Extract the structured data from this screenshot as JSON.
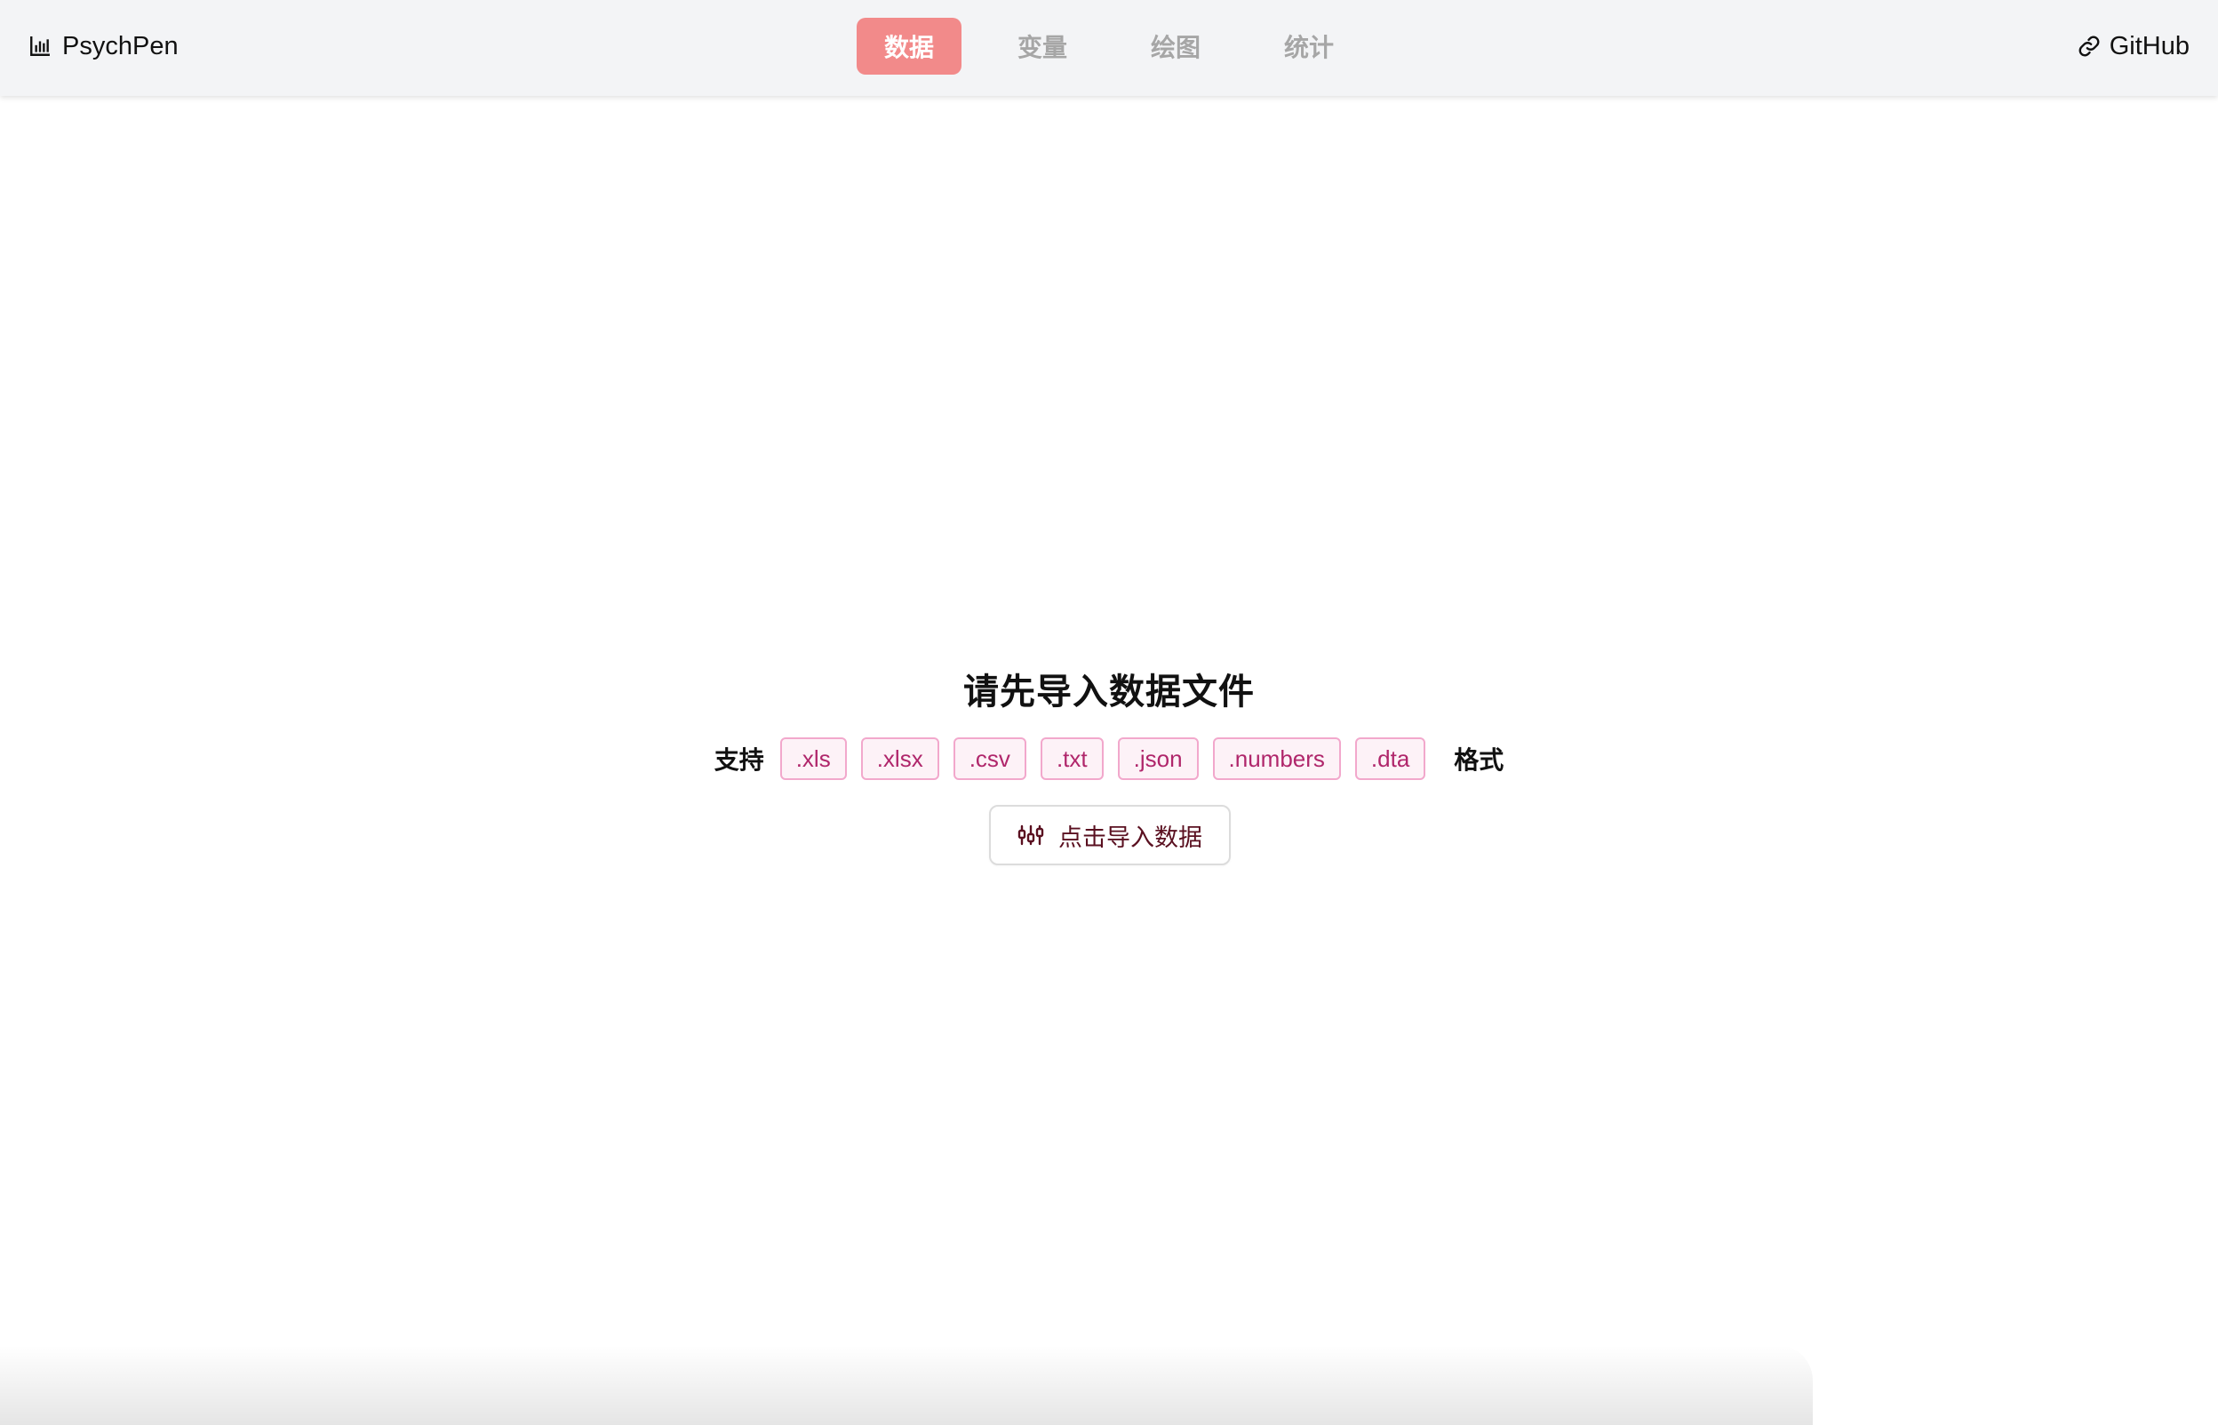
{
  "header": {
    "brand_name": "PsychPen",
    "brand_icon": "bar-chart-icon",
    "tabs": [
      {
        "label": "数据",
        "active": true
      },
      {
        "label": "变量",
        "active": false
      },
      {
        "label": "绘图",
        "active": false
      },
      {
        "label": "统计",
        "active": false
      }
    ],
    "github_label": "GitHub",
    "github_icon": "link-icon"
  },
  "main": {
    "title": "请先导入数据文件",
    "formats_lead": "支持",
    "formats": [
      ".xls",
      ".xlsx",
      ".csv",
      ".txt",
      ".json",
      ".numbers",
      ".dta"
    ],
    "formats_tail": "格式",
    "import_button_label": "点击导入数据",
    "import_button_icon": "sliders-icon"
  },
  "colors": {
    "active_tab_bg": "#f28a8a",
    "chip_text": "#b0266b",
    "chip_border": "#f2a8cc",
    "chip_bg": "#fdf2f7"
  }
}
